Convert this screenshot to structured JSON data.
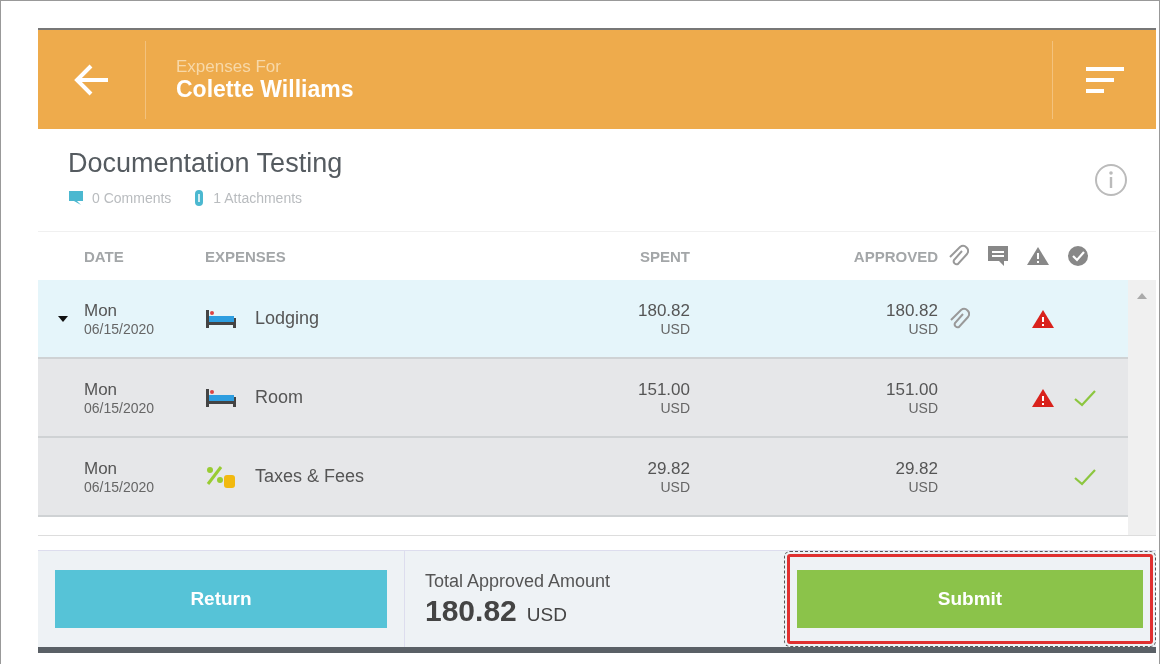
{
  "header": {
    "subtitle": "Expenses For",
    "title": "Colette Williams"
  },
  "report": {
    "title": "Documentation Testing",
    "comments": "0 Comments",
    "attachments": "1 Attachments"
  },
  "table": {
    "columns": [
      "DATE",
      "EXPENSES",
      "SPENT",
      "APPROVED"
    ],
    "rows": [
      {
        "day": "Mon",
        "date": "06/15/2020",
        "kind": "lodging",
        "name": "Lodging",
        "spent": "180.82",
        "spent_currency": "USD",
        "approved": "180.82",
        "approved_currency": "USD",
        "attachment": true,
        "warning": true,
        "approved_check": false,
        "selected": true,
        "expanded": true,
        "children": [
          {
            "day": "Mon",
            "date": "06/15/2020",
            "kind": "lodging",
            "name": "Room",
            "spent": "151.00",
            "spent_currency": "USD",
            "approved": "151.00",
            "approved_currency": "USD",
            "attachment": false,
            "warning": true,
            "approved_check": true,
            "selected": false
          },
          {
            "day": "Mon",
            "date": "06/15/2020",
            "kind": "taxes",
            "name": "Taxes & Fees",
            "spent": "29.82",
            "spent_currency": "USD",
            "approved": "29.82",
            "approved_currency": "USD",
            "attachment": false,
            "warning": false,
            "approved_check": true,
            "selected": false
          }
        ]
      }
    ]
  },
  "footer": {
    "return_label": "Return",
    "total_label": "Total Approved Amount",
    "total": "180.82",
    "currency": "USD",
    "submit_label": "Submit",
    "submit_highlighted": true
  }
}
